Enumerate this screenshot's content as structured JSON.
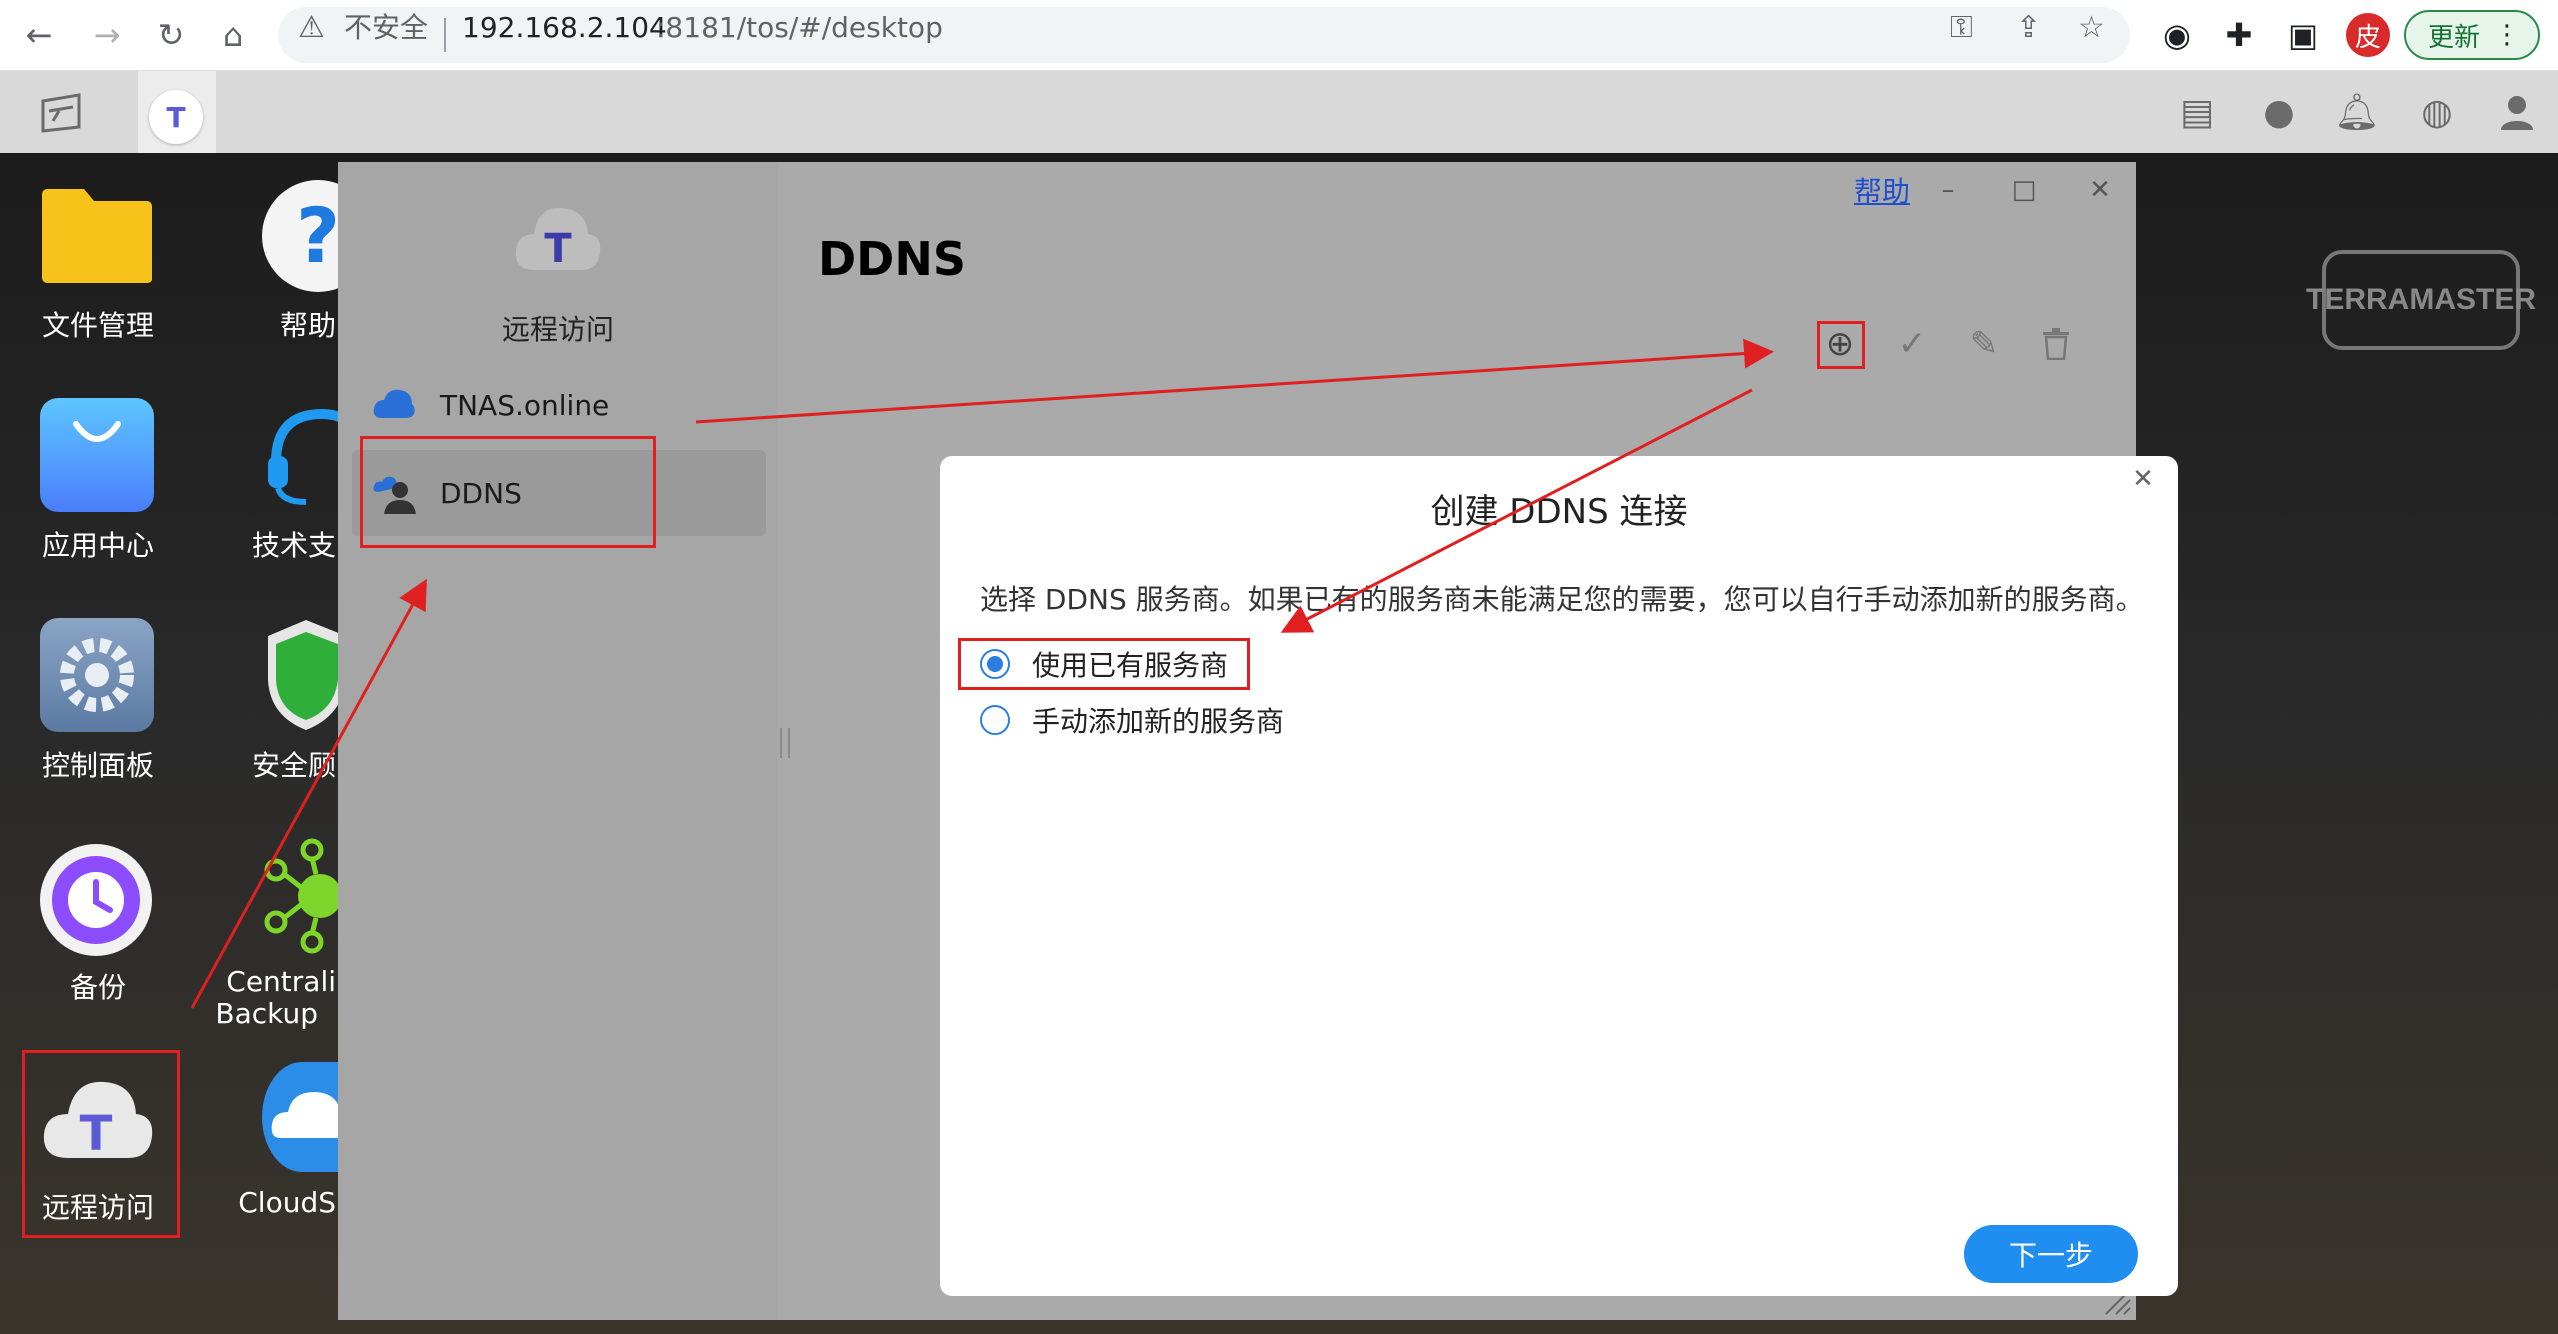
{
  "browser": {
    "security_label": "不安全",
    "url_host": "192.168.2.104",
    "url_rest": ":8181/tos/#/desktop",
    "avatar_letter": "皮",
    "update_label": "更新"
  },
  "tos": {
    "app_letter": "T"
  },
  "desktop": {
    "icons": [
      {
        "label": "文件管理"
      },
      {
        "label": "帮助"
      },
      {
        "label": "应用中心"
      },
      {
        "label": "技术支"
      },
      {
        "label": "控制面板"
      },
      {
        "label": "安全顾"
      },
      {
        "label": "备份"
      },
      {
        "label": "Centrali"
      },
      {
        "label2": "Backup"
      },
      {
        "label": "远程访问"
      },
      {
        "label": "CloudS"
      }
    ],
    "brand": "TERRAMASTER"
  },
  "app": {
    "sidebar_title": "远程访问",
    "items": [
      {
        "label": "TNAS.online"
      },
      {
        "label": "DDNS"
      }
    ],
    "title": "DDNS",
    "help": "帮助"
  },
  "modal": {
    "title": "创建 DDNS 连接",
    "description": "选择 DDNS 服务商。如果已有的服务商未能满足您的需要，您可以自行手动添加新的服务商。",
    "options": [
      {
        "label": "使用已有服务商",
        "checked": true
      },
      {
        "label": "手动添加新的服务商",
        "checked": false
      }
    ],
    "next_label": "下一步"
  },
  "colors": {
    "accent": "#1f8ef0",
    "annotation": "#e02020"
  }
}
